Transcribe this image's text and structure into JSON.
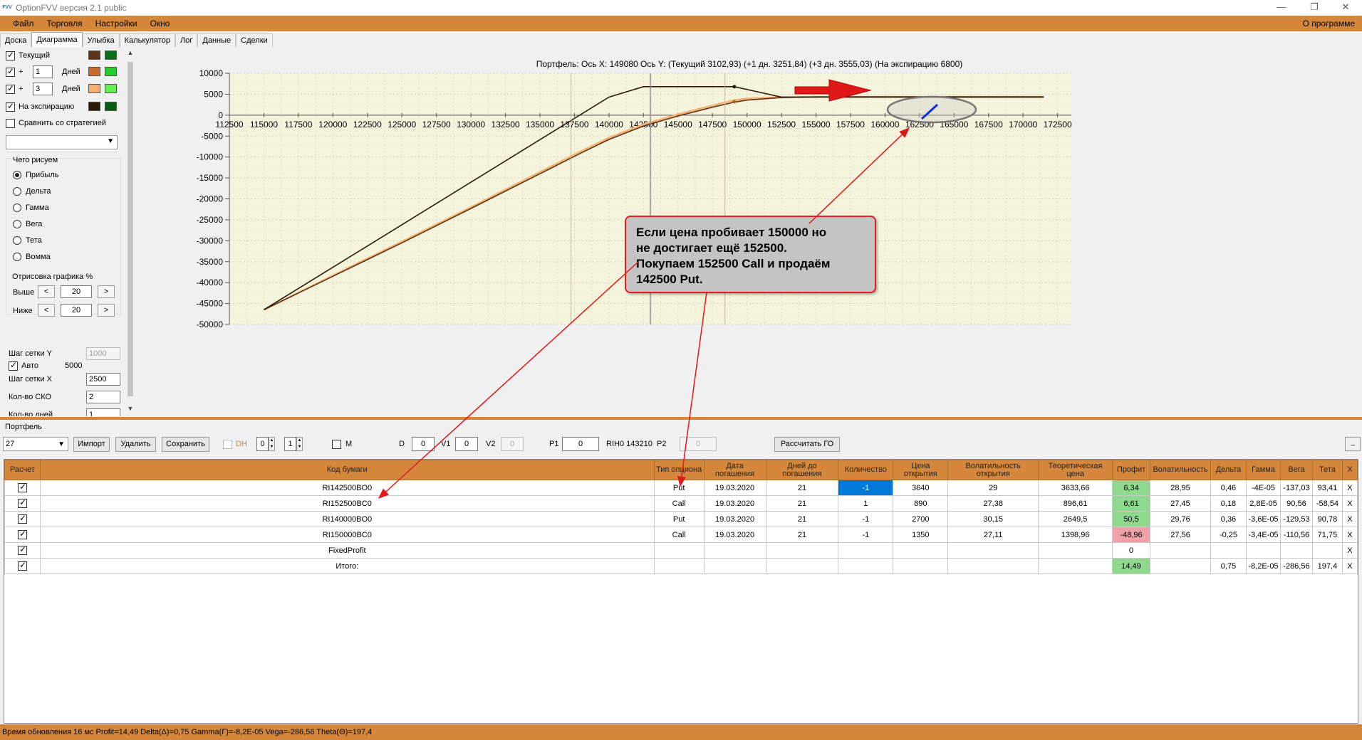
{
  "window": {
    "title": "OptionFVV версия 2.1 public",
    "app_icon": "FVV",
    "minimize_glyph": "—",
    "maximize_glyph": "❐",
    "close_glyph": "✕"
  },
  "menu": {
    "items": [
      "Файл",
      "Торговля",
      "Настройки",
      "Окно"
    ],
    "about": "О программе"
  },
  "tabs": [
    "Доска",
    "Диаграмма",
    "Улыбка",
    "Калькулятор",
    "Лог",
    "Данные",
    "Сделки"
  ],
  "active_tab": "Диаграмма",
  "left_panel": {
    "current_label": "Текущий",
    "plus": "+",
    "days1_value": "1",
    "days_label": "Дней",
    "days2_value": "3",
    "expiry_label": "На экспирацию",
    "compare_label": "Сравнить со стратегией",
    "what_draw_title": "Чего рисуем",
    "draw_options": [
      "Прибыль",
      "Дельта",
      "Гамма",
      "Вега",
      "Тета",
      "Вомма"
    ],
    "render_title": "Отрисовка графика %",
    "above_label": "Выше",
    "below_label": "Ниже",
    "above_value": "20",
    "below_value": "20",
    "spin_left": "<",
    "spin_right": ">",
    "grid_y_label": "Шаг сетки Y",
    "grid_y_value": "1000",
    "auto_label": "Авто",
    "auto_value": "5000",
    "grid_x_label": "Шаг сетки X",
    "grid_x_value": "2500",
    "sko_label": "Кол-во СКО",
    "sko_value": "2",
    "days_count_label": "Кол-во дней",
    "days_count_value": "1",
    "swatch_colors": [
      [
        "#5c3418",
        "#0a6e1a"
      ],
      [
        "#c86a2c",
        "#22cc33"
      ],
      [
        "#f5b070",
        "#66ee55"
      ],
      [
        "#2a1a0a",
        "#0a5a14"
      ]
    ]
  },
  "chart_header": "Портфель: Ось X: 149080 Ось Y:  (Текущий 3102,93)  (+1 дн. 3251,84)  (+3 дн. 3555,03)  (На экспирацию 6800)",
  "chart_data": {
    "type": "line",
    "x_ticks": [
      112500,
      115000,
      117500,
      120000,
      122500,
      125000,
      127500,
      130000,
      132500,
      135000,
      137500,
      140000,
      142500,
      145000,
      147500,
      150000,
      152500,
      155000,
      157500,
      160000,
      162500,
      165000,
      167500,
      170000,
      172500
    ],
    "y_ticks": [
      10000,
      5000,
      0,
      -5000,
      -10000,
      -15000,
      -20000,
      -25000,
      -30000,
      -35000,
      -40000,
      -45000,
      -50000
    ],
    "xlim": [
      112500,
      173500
    ],
    "ylim": [
      -50000,
      10000
    ],
    "grid": true,
    "series": [
      {
        "color": "#2a1a0a",
        "points": [
          [
            115000,
            -46500
          ],
          [
            140000,
            4300
          ],
          [
            142500,
            6800
          ],
          [
            149080,
            6800
          ],
          [
            152500,
            4300
          ],
          [
            171500,
            4300
          ]
        ]
      },
      {
        "color": "#5c3418",
        "points": [
          [
            115000,
            -46500
          ],
          [
            120000,
            -38500
          ],
          [
            125000,
            -30500
          ],
          [
            130000,
            -22300
          ],
          [
            135000,
            -14000
          ],
          [
            138000,
            -9000
          ],
          [
            140000,
            -5800
          ],
          [
            142500,
            -2600
          ],
          [
            145000,
            -200
          ],
          [
            147500,
            1900
          ],
          [
            149080,
            3103
          ],
          [
            150000,
            3600
          ],
          [
            152500,
            4200
          ],
          [
            155000,
            4350
          ],
          [
            160000,
            4380
          ],
          [
            171500,
            4380
          ]
        ]
      },
      {
        "color": "#f5b070",
        "points": [
          [
            115000,
            -46500
          ],
          [
            120000,
            -38300
          ],
          [
            125000,
            -30200
          ],
          [
            130000,
            -22000
          ],
          [
            135000,
            -13600
          ],
          [
            138000,
            -8600
          ],
          [
            140000,
            -5400
          ],
          [
            142500,
            -2200
          ],
          [
            145000,
            200
          ],
          [
            147500,
            2300
          ],
          [
            149080,
            3555
          ],
          [
            150000,
            3950
          ],
          [
            152500,
            4300
          ],
          [
            155000,
            4380
          ],
          [
            171500,
            4380
          ]
        ]
      }
    ],
    "markers": {
      "current_x": 143000,
      "sko_x": [
        137250,
        148400
      ]
    }
  },
  "annotation": {
    "lines": [
      "Если цена пробивает 150000 но",
      "не достигает ещё 152500.",
      "Покупаем 152500 Call и продаём",
      "142500 Put."
    ]
  },
  "portfolio": {
    "label": "Портфель",
    "combo_value": "27",
    "import_btn": "Импорт",
    "delete_btn": "Удалить",
    "save_btn": "Сохранить",
    "dh_label": "DH",
    "dh_v1": "0",
    "dh_v2": "1",
    "m_label": "M",
    "d_label": "D",
    "d_value": "0",
    "v1_label": "V1",
    "v1_value": "0",
    "v2_label": "V2",
    "v2_value": "0",
    "p1_label": "P1",
    "p1_value": "0",
    "ticker_label": "RIH0 143210",
    "p2_label": "P2",
    "p2_value": "0",
    "calc_go_btn": "Рассчитать ГО",
    "minimize_btn": "_"
  },
  "table": {
    "headers": [
      "Расчет",
      "Код бумаги",
      "Тип опциона",
      "Дата погашения",
      "Дней до погашения",
      "Количество",
      "Цена открытия",
      "Волатильность открытия",
      "Теоретическая цена",
      "Профит",
      "Волатильность",
      "Дельта",
      "Гамма",
      "Вега",
      "Тета",
      "X"
    ],
    "rows": [
      [
        "RI142500BO0",
        "Put",
        "19.03.2020",
        "21",
        "-1",
        "3640",
        "29",
        "3633,66",
        "6,34",
        "28,95",
        "0,46",
        "-4E-05",
        "-137,03",
        "93,41",
        "X"
      ],
      [
        "RI152500BC0",
        "Call",
        "19.03.2020",
        "21",
        "1",
        "890",
        "27,38",
        "896,61",
        "6,61",
        "27,45",
        "0,18",
        "2,8E-05",
        "90,56",
        "-58,54",
        "X"
      ],
      [
        "RI140000BO0",
        "Put",
        "19.03.2020",
        "21",
        "-1",
        "2700",
        "30,15",
        "2649,5",
        "50,5",
        "29,76",
        "0,36",
        "-3,6E-05",
        "-129,53",
        "90,78",
        "X"
      ],
      [
        "RI150000BC0",
        "Call",
        "19.03.2020",
        "21",
        "-1",
        "1350",
        "27,11",
        "1398,96",
        "-48,96",
        "27,56",
        "-0,25",
        "-3,4E-05",
        "-110,56",
        "71,75",
        "X"
      ],
      [
        "FixedProfit",
        "",
        "",
        "",
        "",
        "",
        "",
        "",
        "0",
        "",
        "",
        "",
        "",
        "",
        "X"
      ],
      [
        "Итого:",
        "",
        "",
        "",
        "",
        "",
        "",
        "",
        "14,49",
        "",
        "0,75",
        "-8,2E-05",
        "-286,56",
        "197,4",
        "X"
      ]
    ]
  },
  "status": "Время обновления 16 мс  Profit=14,49 Delta(Δ)=0,75 Gamma(Γ)=-8,2E-05 Vega=-286,56 Theta(Θ)=197,4"
}
